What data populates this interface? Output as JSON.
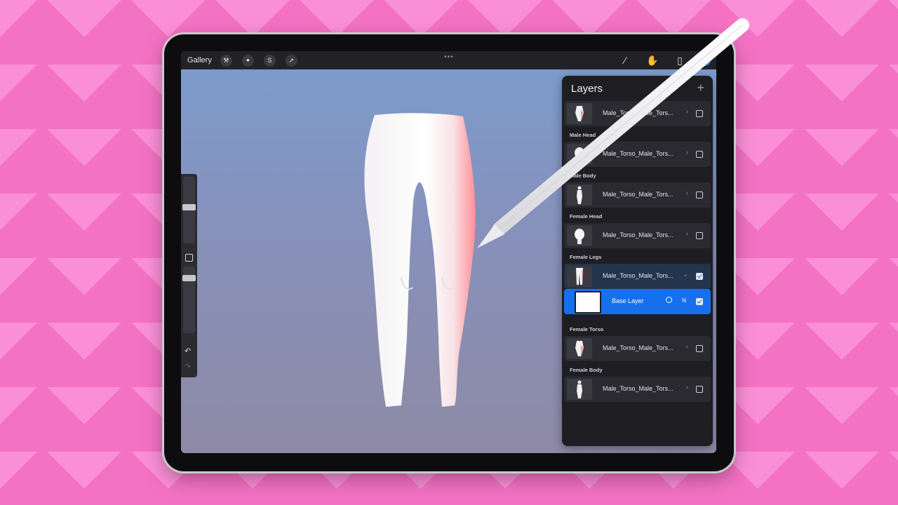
{
  "app": {
    "gallery_label": "Gallery",
    "top_tools": [
      "wrench-icon",
      "magic-wand-icon",
      "selection-icon",
      "transform-arrow-icon"
    ],
    "right_tools": [
      "brush-icon",
      "smudge-icon",
      "eraser-icon",
      "layers-icon"
    ],
    "accent_color": "#1573ff"
  },
  "layers_panel": {
    "title": "Layers",
    "add_label": "+",
    "groups": [
      {
        "label": "",
        "rows": [
          {
            "name": "Male_Torso_Male_Tors...",
            "thumb": "torso",
            "checked": false
          }
        ]
      },
      {
        "label": "Male Head",
        "rows": [
          {
            "name": "Male_Torso_Male_Tors...",
            "thumb": "head",
            "checked": false
          }
        ]
      },
      {
        "label": "Male Body",
        "rows": [
          {
            "name": "Male_Torso_Male_Tors...",
            "thumb": "body",
            "checked": false
          }
        ]
      },
      {
        "label": "Female Head",
        "rows": [
          {
            "name": "Male_Torso_Male_Tors...",
            "thumb": "head",
            "checked": false
          }
        ]
      },
      {
        "label": "Female Legs",
        "rows": [
          {
            "name": "Male_Torso_Male_Tors...",
            "thumb": "legs",
            "checked": true
          }
        ]
      },
      {
        "label": "Female Torso",
        "rows": [
          {
            "name": "Male_Torso_Male_Tors...",
            "thumb": "torso",
            "checked": false
          }
        ]
      },
      {
        "label": "Female Body",
        "rows": [
          {
            "name": "Male_Torso_Male_Tors...",
            "thumb": "body",
            "checked": false
          }
        ]
      }
    ],
    "base_layer": {
      "name": "Base Layer",
      "blend": "N",
      "checked": true
    }
  }
}
